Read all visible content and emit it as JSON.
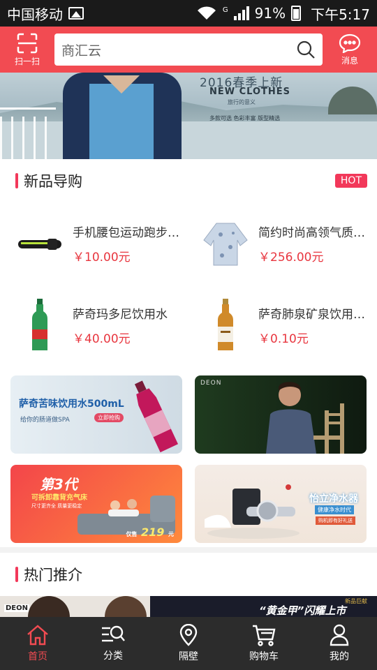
{
  "status_bar": {
    "carrier": "中国移动",
    "network": "G",
    "battery": "91%",
    "time": "下午5:17"
  },
  "header": {
    "scan_label": "扫一扫",
    "search_text": "商汇云",
    "messages_label": "消息"
  },
  "banner": {
    "title": "2016春季上新",
    "subtitle": "NEW CLOTHES",
    "tagline": "旅行的意义",
    "features": "多款可选 色彩丰富 版型精选"
  },
  "new_products": {
    "title": "新品导购",
    "badge": "HOT",
    "items": [
      {
        "name": "手机腰包运动跑步…",
        "price": "￥10.00元"
      },
      {
        "name": "简约时尚高领气质…",
        "price": "￥256.00元"
      },
      {
        "name": "萨奇玛多尼饮用水",
        "price": "￥40.00元"
      },
      {
        "name": "萨奇肺泉矿泉饮用…",
        "price": "￥0.10元"
      }
    ]
  },
  "ads": [
    {
      "headline": "萨奇苦味饮用水500mL",
      "sub": "给你的肠道做SPA",
      "cta": "立即抢购"
    },
    {
      "brand": "DEON"
    },
    {
      "headline": "第3代",
      "sub": "可拆卸靠背充气床",
      "detail": "尺寸更齐全 质量更稳定",
      "price_label": "仅售",
      "price": "219",
      "unit": "元"
    },
    {
      "headline": "怡立净水器",
      "sub": "健康净水时代",
      "cta": "购机即有好礼送"
    }
  ],
  "hot_recommend": {
    "title": "热门推介",
    "strip_left_brand": "DEON",
    "strip_right_text": "“黄金甲”闪耀上市",
    "strip_right_tag": "新品巨献"
  },
  "bottom_nav": [
    {
      "label": "首页",
      "icon": "home-icon",
      "active": true
    },
    {
      "label": "分类",
      "icon": "category-search-icon",
      "active": false
    },
    {
      "label": "隔壁",
      "icon": "location-pin-icon",
      "active": false
    },
    {
      "label": "购物车",
      "icon": "cart-icon",
      "active": false
    },
    {
      "label": "我的",
      "icon": "user-icon",
      "active": false
    }
  ],
  "colors": {
    "brand_red": "#f24b52",
    "price_red": "#e8363f",
    "accent_pink": "#f2385a",
    "nav_bg": "#2c2c2c"
  }
}
